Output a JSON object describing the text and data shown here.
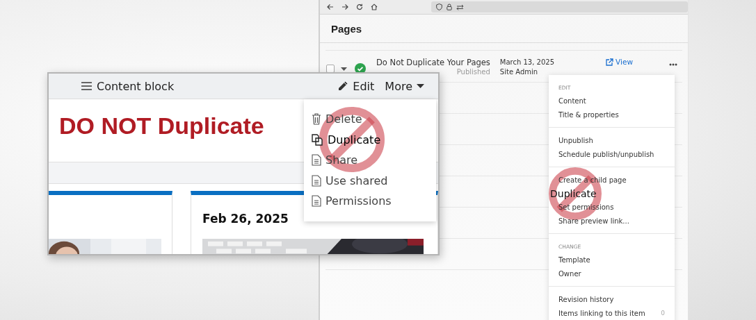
{
  "browser": {
    "title": "Pages",
    "page_row": {
      "checked": false,
      "title": "Do Not Duplicate Your Pages",
      "status": "Published",
      "date": "March 13, 2025",
      "author": "Site Admin",
      "view_link": "View"
    },
    "actions_menu": {
      "sections": [
        {
          "heading": "EDIT",
          "items": [
            {
              "label": "Content",
              "highlighted": false
            },
            {
              "label": "Title & properties",
              "highlighted": false
            }
          ]
        },
        {
          "items": [
            {
              "label": "Unpublish",
              "highlighted": false
            },
            {
              "label": "Schedule publish/unpublish",
              "highlighted": false
            }
          ]
        },
        {
          "items": [
            {
              "label": "Create a child page",
              "highlighted": false
            },
            {
              "label": "Duplicate",
              "highlighted": true
            },
            {
              "label": "Set permissions",
              "highlighted": false
            },
            {
              "label": "Share preview link...",
              "highlighted": false
            }
          ]
        },
        {
          "heading": "CHANGE",
          "items": [
            {
              "label": "Template",
              "highlighted": false
            },
            {
              "label": "Owner",
              "highlighted": false
            }
          ]
        },
        {
          "items": [
            {
              "label": "Revision history",
              "highlighted": false
            },
            {
              "label": "Items linking to this item",
              "count": "0",
              "highlighted": false
            }
          ]
        }
      ]
    }
  },
  "content_block": {
    "title": "Content block",
    "edit_label": "Edit",
    "more_label": "More",
    "heading": "DO NOT Duplicate",
    "card_date": "Feb 26, 2025",
    "more_menu": [
      {
        "label": "Delete",
        "kind": "trash",
        "highlighted": false
      },
      {
        "label": "Duplicate",
        "kind": "copy",
        "highlighted": true
      },
      {
        "label": "Share",
        "kind": "document",
        "highlighted": false
      },
      {
        "label": "Use shared",
        "kind": "document",
        "highlighted": false
      },
      {
        "label": "Permissions",
        "kind": "document",
        "highlighted": false
      }
    ]
  }
}
